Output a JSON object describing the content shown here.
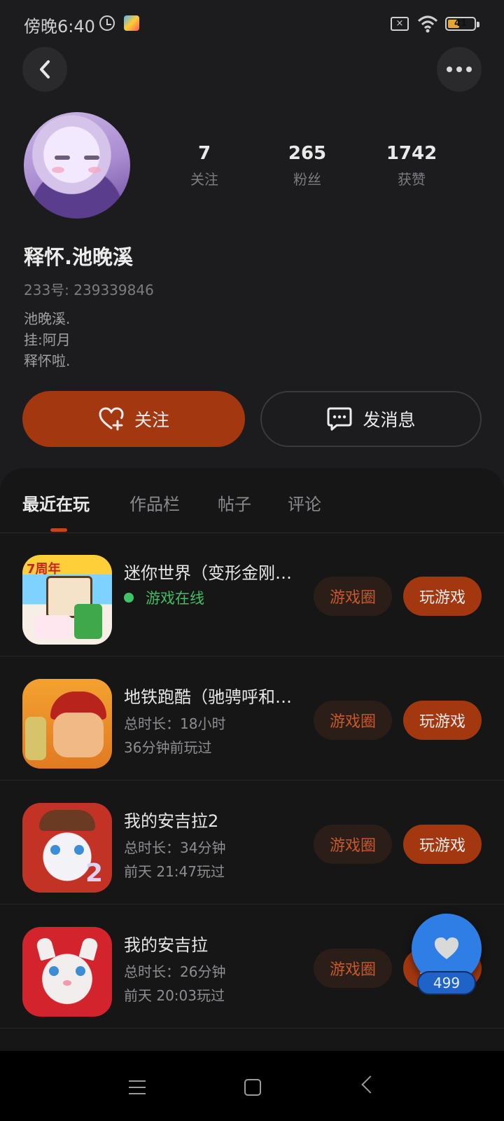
{
  "status": {
    "time": "傍晚6:40",
    "battery": "41"
  },
  "profile": {
    "following_count": "7",
    "following_label": "关注",
    "fans_count": "265",
    "fans_label": "粉丝",
    "likes_count": "1742",
    "likes_label": "获赞",
    "nickname": "释怀.池晚溪",
    "uid": "233号: 239339846",
    "bio": [
      "池晚溪.",
      "挂:阿月",
      "释怀啦."
    ]
  },
  "actions": {
    "follow_label": "关注",
    "message_label": "发消息"
  },
  "tabs": [
    "最近在玩",
    "作品栏",
    "帖子",
    "评论"
  ],
  "games": [
    {
      "title": "迷你世界（变形金刚…",
      "status": "游戏在线",
      "circle_label": "游戏圈",
      "play_label": "玩游戏"
    },
    {
      "title": "地铁跑酷（驰骋呼和…",
      "duration": "总时长：18小时",
      "last_played": "36分钟前玩过",
      "circle_label": "游戏圈",
      "play_label": "玩游戏"
    },
    {
      "title": "我的安吉拉2",
      "duration": "总时长：34分钟",
      "last_played": "前天 21:47玩过",
      "circle_label": "游戏圈",
      "play_label": "玩游戏"
    },
    {
      "title": "我的安吉拉",
      "duration": "总时长：26分钟",
      "last_played": "前天 20:03玩过",
      "circle_label": "游戏圈",
      "play_label": "玩游戏"
    }
  ],
  "like_fab": {
    "count": "499"
  },
  "colors": {
    "accent": "#a3370f",
    "online": "#3fc46a",
    "fab": "#2f7ee6"
  }
}
